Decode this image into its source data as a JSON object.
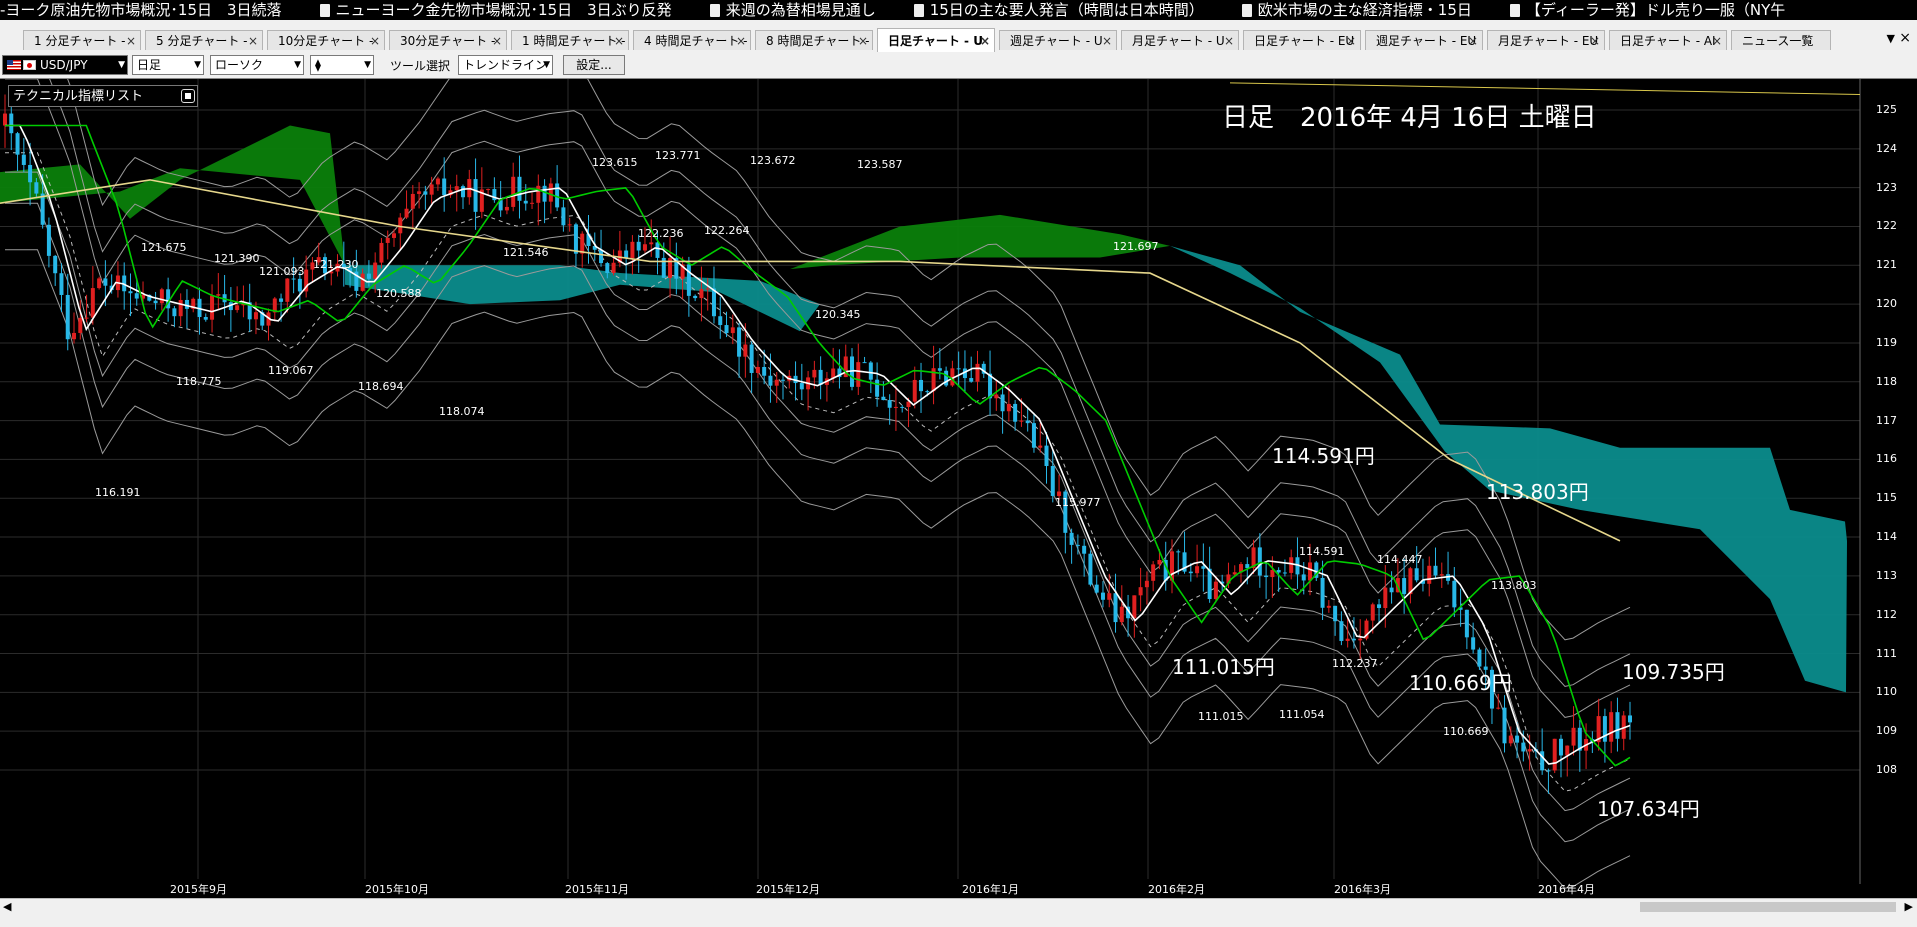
{
  "ticker": [
    "-ヨーク原油先物市場概況･15日　3日続落",
    "ニューヨーク金先物市場概況･15日　3日ぶり反発",
    "来週の為替相場見通し",
    "15日の主な要人発言（時間は日本時間）",
    "欧米市場の主な経済指標・15日",
    "【ディーラー発】ドル売り一服（NY午"
  ],
  "tabs": [
    {
      "label": "1 分足チャート - "
    },
    {
      "label": "5 分足チャート - "
    },
    {
      "label": "10分足チャート - "
    },
    {
      "label": "30分足チャート - "
    },
    {
      "label": "1 時間足チャート - "
    },
    {
      "label": "4 時間足チャート - "
    },
    {
      "label": "8 時間足チャート - "
    },
    {
      "label": "日足チャート - U"
    },
    {
      "label": "週足チャート - U"
    },
    {
      "label": "月足チャート - U"
    },
    {
      "label": "日足チャート - EU"
    },
    {
      "label": "週足チャート - EU"
    },
    {
      "label": "月足チャート - EU"
    },
    {
      "label": "日足チャート - AI"
    },
    {
      "label": "ニュース一覧"
    }
  ],
  "tab_close_glyph": "×",
  "toolbar": {
    "pair": "USD/JPY",
    "period": "日足",
    "chart_type": "ローソク",
    "tool_label": "ツール選択",
    "tool_value": "トレンドライン",
    "settings": "設定..."
  },
  "overlay": {
    "tech_list": "テクニカル指標リスト",
    "date_header": "日足　2016年 4月 16日 土曜日"
  },
  "annotations": [
    {
      "text": "114.591円"
    },
    {
      "text": "113.803円"
    },
    {
      "text": "111.015円"
    },
    {
      "text": "110.669円"
    },
    {
      "text": "109.735円"
    },
    {
      "text": "107.634円"
    }
  ],
  "price_labels": [
    "121.675",
    "121.390",
    "121.093",
    "121.230",
    "118.775",
    "119.067",
    "118.694",
    "120.588",
    "118.074",
    "121.546",
    "123.615",
    "123.771",
    "122.236",
    "122.264",
    "123.672",
    "123.587",
    "120.345",
    "121.697",
    "115.977",
    "116.191",
    "114.591",
    "114.447",
    "113.803",
    "112.237",
    "111.015",
    "111.054",
    "110.669"
  ],
  "chart_data": {
    "type": "candlestick",
    "symbol": "USD/JPY",
    "timeframe": "日足",
    "ylim": [
      107.6,
      125.6
    ],
    "y_ticks": [
      125,
      124,
      123,
      122,
      121,
      120,
      119,
      118,
      117,
      116,
      115,
      114,
      113,
      112,
      111,
      110,
      109,
      108
    ],
    "x_ticks": [
      "2015年9月",
      "2015年10月",
      "2015年11月",
      "2015年12月",
      "2016年1月",
      "2016年2月",
      "2016年3月",
      "2016年4月"
    ],
    "close_path": [
      124.6,
      122.5,
      119.3,
      120.6,
      120.2,
      120.0,
      119.8,
      120.1,
      119.5,
      120.5,
      121.0,
      120.5,
      121.5,
      122.7,
      123.0,
      122.7,
      122.9,
      123.0,
      121.5,
      121.0,
      121.5,
      120.8,
      120.2,
      119.0,
      118.1,
      117.9,
      118.3,
      118.2,
      117.4,
      118.0,
      118.4,
      117.8,
      117.0,
      115.0,
      113.0,
      111.8,
      113.0,
      113.4,
      112.5,
      113.4,
      113.3,
      113.0,
      111.3,
      112.1,
      112.9,
      113.0,
      111.6,
      109.0,
      108.1,
      108.6,
      109.0,
      109.3
    ],
    "series": [
      {
        "name": "",
        "color": "#ffffff"
      },
      {
        "name": "",
        "color": "#00cc00"
      },
      {
        "name": "",
        "color": "#e6d78c"
      }
    ],
    "colors": {
      "up": "#e02020",
      "down": "#28b8e8",
      "cloud_bull": "#0b7f0b",
      "cloud_bear": "#0b8c8c",
      "bands": "#9a9a9a"
    },
    "grid": true
  }
}
